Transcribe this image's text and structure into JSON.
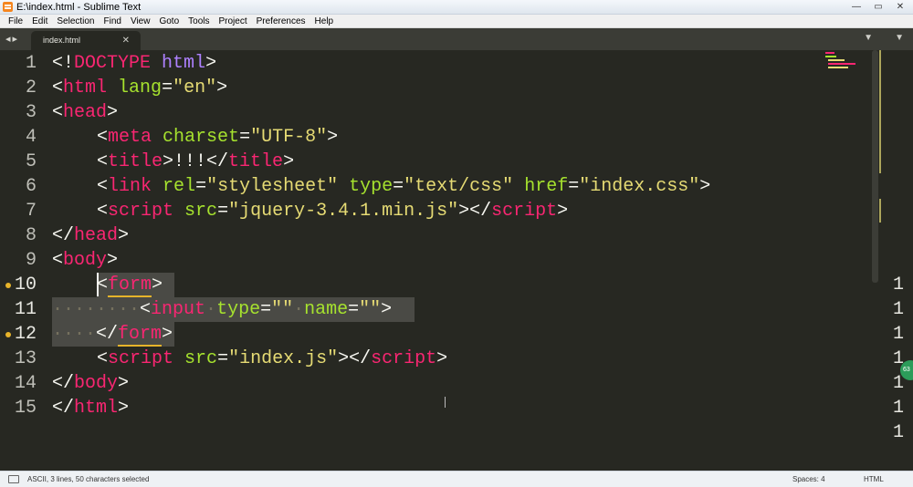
{
  "window": {
    "title": "E:\\index.html - Sublime Text",
    "minimize": "—",
    "maximize": "▭",
    "close": "✕"
  },
  "menu": {
    "items": [
      "File",
      "Edit",
      "Selection",
      "Find",
      "View",
      "Goto",
      "Tools",
      "Project",
      "Preferences",
      "Help"
    ]
  },
  "tabs": {
    "nav": "◂▸",
    "active": "index.html",
    "close": "✕",
    "dropdown": "▼",
    "overflow": "▼"
  },
  "gutter": {
    "lines": [
      "1",
      "2",
      "3",
      "4",
      "5",
      "6",
      "7",
      "8",
      "9",
      "10",
      "11",
      "12",
      "13",
      "14",
      "15"
    ]
  },
  "code": {
    "l1": [
      "<!",
      "DOCTYPE",
      " ",
      "html",
      ">"
    ],
    "l2": [
      "<",
      "html",
      " ",
      "lang",
      "=",
      "\"en\"",
      ">"
    ],
    "l3": [
      "<",
      "head",
      ">"
    ],
    "l4": [
      "<",
      "meta",
      " ",
      "charset",
      "=",
      "\"UTF-8\"",
      ">"
    ],
    "l5": [
      "<",
      "title",
      ">!!!</",
      "title",
      ">"
    ],
    "l6": [
      "<",
      "link",
      " ",
      "rel",
      "=",
      "\"stylesheet\"",
      " ",
      "type",
      "=",
      "\"text/css\"",
      " ",
      "href",
      "=",
      "\"index.css\"",
      ">"
    ],
    "l7": [
      "<",
      "script",
      " ",
      "src",
      "=",
      "\"jquery-3.4.1.min.js\"",
      "></",
      "script",
      ">"
    ],
    "l8": [
      "</",
      "head",
      ">"
    ],
    "l9": [
      "<",
      "body",
      ">"
    ],
    "l10": [
      "<",
      "form",
      ">"
    ],
    "l11": [
      "········",
      "<",
      "input",
      "·",
      "type",
      "=",
      "\"\"",
      "·",
      "name",
      "=",
      "\"\"",
      ">"
    ],
    "l12": [
      "····",
      "</",
      "form",
      ">"
    ],
    "l13": [
      "<",
      "script",
      " ",
      "src",
      "=",
      "\"index.js\"",
      "></",
      "script",
      ">"
    ],
    "l14": [
      "</",
      "body",
      ">"
    ],
    "l15": [
      "</",
      "html",
      ">"
    ]
  },
  "right_col": [
    "1",
    "1",
    "1",
    "1",
    "1",
    "1",
    "1"
  ],
  "badge": "63",
  "status": {
    "left": "ASCII, 3 lines, 50 characters selected",
    "spaces": "Spaces: 4",
    "syntax": "HTML"
  },
  "colors": {
    "background": "#272822",
    "tag": "#f92672",
    "attribute": "#a6e22e",
    "string": "#e6db74",
    "doctype": "#ae81ff",
    "text": "#f8f8f2",
    "selection": "#4a4a45",
    "bookmark": "#e8b42a"
  }
}
